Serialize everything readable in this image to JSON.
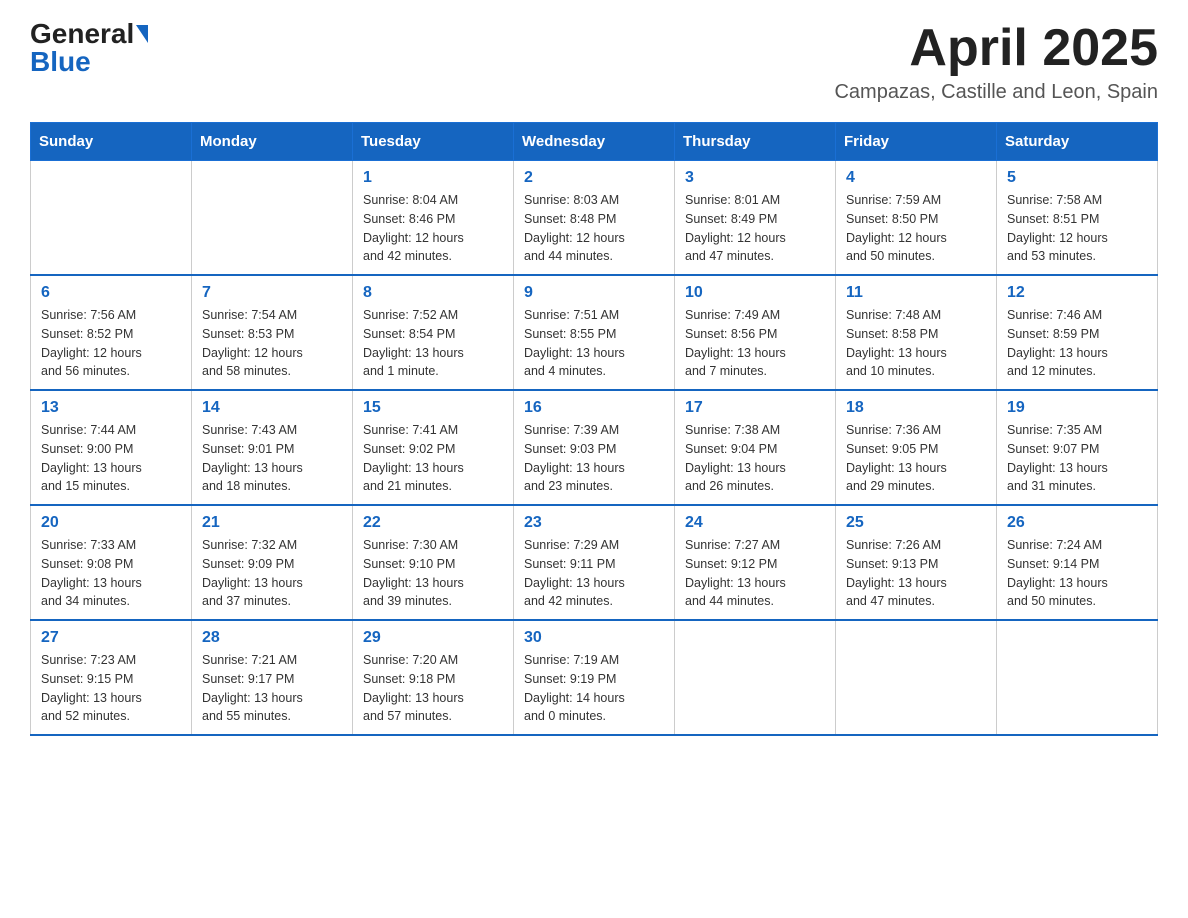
{
  "header": {
    "logo_general": "General",
    "logo_blue": "Blue",
    "title": "April 2025",
    "location": "Campazas, Castille and Leon, Spain"
  },
  "weekdays": [
    "Sunday",
    "Monday",
    "Tuesday",
    "Wednesday",
    "Thursday",
    "Friday",
    "Saturday"
  ],
  "weeks": [
    [
      {
        "day": "",
        "info": ""
      },
      {
        "day": "",
        "info": ""
      },
      {
        "day": "1",
        "info": "Sunrise: 8:04 AM\nSunset: 8:46 PM\nDaylight: 12 hours\nand 42 minutes."
      },
      {
        "day": "2",
        "info": "Sunrise: 8:03 AM\nSunset: 8:48 PM\nDaylight: 12 hours\nand 44 minutes."
      },
      {
        "day": "3",
        "info": "Sunrise: 8:01 AM\nSunset: 8:49 PM\nDaylight: 12 hours\nand 47 minutes."
      },
      {
        "day": "4",
        "info": "Sunrise: 7:59 AM\nSunset: 8:50 PM\nDaylight: 12 hours\nand 50 minutes."
      },
      {
        "day": "5",
        "info": "Sunrise: 7:58 AM\nSunset: 8:51 PM\nDaylight: 12 hours\nand 53 minutes."
      }
    ],
    [
      {
        "day": "6",
        "info": "Sunrise: 7:56 AM\nSunset: 8:52 PM\nDaylight: 12 hours\nand 56 minutes."
      },
      {
        "day": "7",
        "info": "Sunrise: 7:54 AM\nSunset: 8:53 PM\nDaylight: 12 hours\nand 58 minutes."
      },
      {
        "day": "8",
        "info": "Sunrise: 7:52 AM\nSunset: 8:54 PM\nDaylight: 13 hours\nand 1 minute."
      },
      {
        "day": "9",
        "info": "Sunrise: 7:51 AM\nSunset: 8:55 PM\nDaylight: 13 hours\nand 4 minutes."
      },
      {
        "day": "10",
        "info": "Sunrise: 7:49 AM\nSunset: 8:56 PM\nDaylight: 13 hours\nand 7 minutes."
      },
      {
        "day": "11",
        "info": "Sunrise: 7:48 AM\nSunset: 8:58 PM\nDaylight: 13 hours\nand 10 minutes."
      },
      {
        "day": "12",
        "info": "Sunrise: 7:46 AM\nSunset: 8:59 PM\nDaylight: 13 hours\nand 12 minutes."
      }
    ],
    [
      {
        "day": "13",
        "info": "Sunrise: 7:44 AM\nSunset: 9:00 PM\nDaylight: 13 hours\nand 15 minutes."
      },
      {
        "day": "14",
        "info": "Sunrise: 7:43 AM\nSunset: 9:01 PM\nDaylight: 13 hours\nand 18 minutes."
      },
      {
        "day": "15",
        "info": "Sunrise: 7:41 AM\nSunset: 9:02 PM\nDaylight: 13 hours\nand 21 minutes."
      },
      {
        "day": "16",
        "info": "Sunrise: 7:39 AM\nSunset: 9:03 PM\nDaylight: 13 hours\nand 23 minutes."
      },
      {
        "day": "17",
        "info": "Sunrise: 7:38 AM\nSunset: 9:04 PM\nDaylight: 13 hours\nand 26 minutes."
      },
      {
        "day": "18",
        "info": "Sunrise: 7:36 AM\nSunset: 9:05 PM\nDaylight: 13 hours\nand 29 minutes."
      },
      {
        "day": "19",
        "info": "Sunrise: 7:35 AM\nSunset: 9:07 PM\nDaylight: 13 hours\nand 31 minutes."
      }
    ],
    [
      {
        "day": "20",
        "info": "Sunrise: 7:33 AM\nSunset: 9:08 PM\nDaylight: 13 hours\nand 34 minutes."
      },
      {
        "day": "21",
        "info": "Sunrise: 7:32 AM\nSunset: 9:09 PM\nDaylight: 13 hours\nand 37 minutes."
      },
      {
        "day": "22",
        "info": "Sunrise: 7:30 AM\nSunset: 9:10 PM\nDaylight: 13 hours\nand 39 minutes."
      },
      {
        "day": "23",
        "info": "Sunrise: 7:29 AM\nSunset: 9:11 PM\nDaylight: 13 hours\nand 42 minutes."
      },
      {
        "day": "24",
        "info": "Sunrise: 7:27 AM\nSunset: 9:12 PM\nDaylight: 13 hours\nand 44 minutes."
      },
      {
        "day": "25",
        "info": "Sunrise: 7:26 AM\nSunset: 9:13 PM\nDaylight: 13 hours\nand 47 minutes."
      },
      {
        "day": "26",
        "info": "Sunrise: 7:24 AM\nSunset: 9:14 PM\nDaylight: 13 hours\nand 50 minutes."
      }
    ],
    [
      {
        "day": "27",
        "info": "Sunrise: 7:23 AM\nSunset: 9:15 PM\nDaylight: 13 hours\nand 52 minutes."
      },
      {
        "day": "28",
        "info": "Sunrise: 7:21 AM\nSunset: 9:17 PM\nDaylight: 13 hours\nand 55 minutes."
      },
      {
        "day": "29",
        "info": "Sunrise: 7:20 AM\nSunset: 9:18 PM\nDaylight: 13 hours\nand 57 minutes."
      },
      {
        "day": "30",
        "info": "Sunrise: 7:19 AM\nSunset: 9:19 PM\nDaylight: 14 hours\nand 0 minutes."
      },
      {
        "day": "",
        "info": ""
      },
      {
        "day": "",
        "info": ""
      },
      {
        "day": "",
        "info": ""
      }
    ]
  ]
}
